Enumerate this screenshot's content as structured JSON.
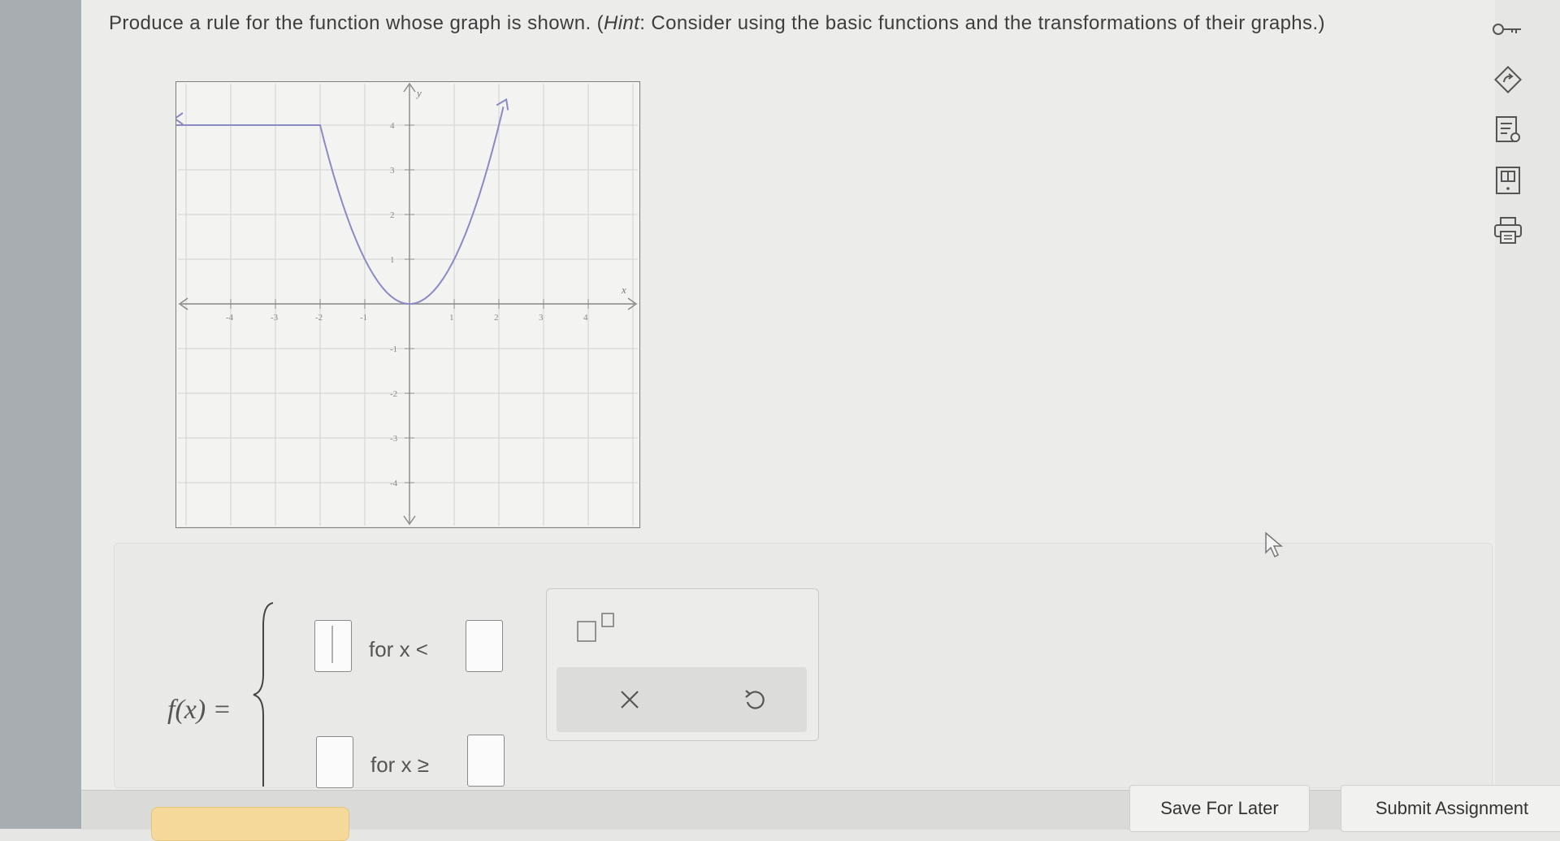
{
  "question": {
    "text_before": "Produce a rule for the function whose graph is shown. (",
    "hint_label": "Hint",
    "text_after": ": Consider using the basic functions and the transformations of their graphs.)"
  },
  "graph": {
    "x_axis_label": "x",
    "y_axis_label": "y",
    "x_tick_labels": [
      "-4",
      "-3",
      "-2",
      "-1",
      "1",
      "2",
      "3",
      "4"
    ],
    "y_tick_labels": [
      "4",
      "3",
      "2",
      "1",
      "-1",
      "-2",
      "-3",
      "-4"
    ]
  },
  "answer": {
    "function_label": "f(x) =",
    "row1_condition": "for x <",
    "row2_condition": "for x ≥"
  },
  "buttons": {
    "save_for_later": "Save For Later",
    "submit_assignment": "Submit Assignment"
  },
  "icons": {
    "tools": [
      "key-icon",
      "redo-icon",
      "notes-icon",
      "book-icon",
      "print-icon"
    ],
    "palette": [
      "exponent-icon",
      "clear-icon",
      "undo-icon"
    ]
  },
  "colors": {
    "curve": "#8a8ac4",
    "check_button": "#f4d99a"
  }
}
